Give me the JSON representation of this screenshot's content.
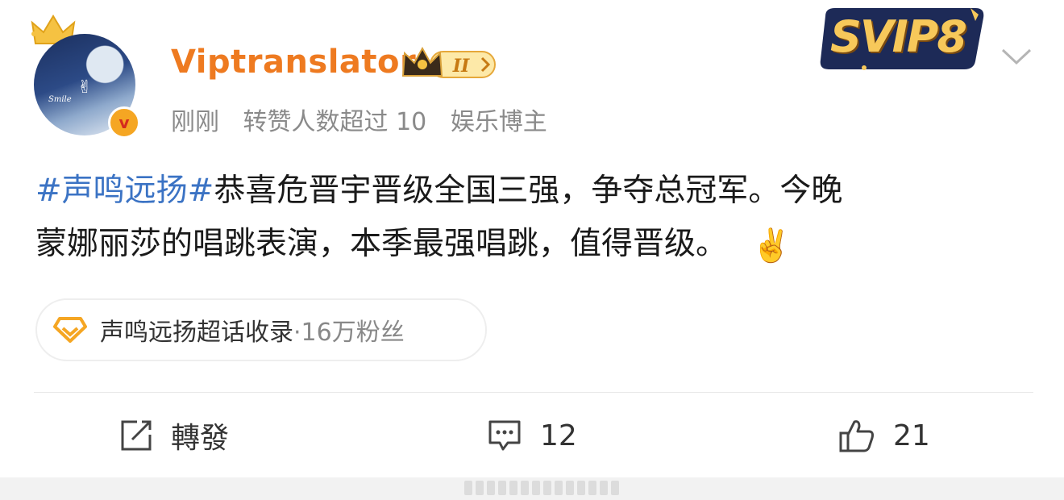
{
  "author": {
    "name": "Viptranslator",
    "level_badge": "II",
    "verified_mark": "v",
    "avatar_text": "Smile",
    "meta": {
      "time": "刚刚",
      "repost_note": "转赞人数超过 10",
      "role": "娱乐博主"
    }
  },
  "vip_badge": "SVIP8",
  "post": {
    "hashtag": "#声鸣远扬#",
    "text_line1_rest": "恭喜危晋宇晋级全国三强，争夺总冠军。今晚",
    "text_line2": "蒙娜丽莎的唱跳表演，本季最强唱跳，值得晋级。",
    "emoji": "✌️"
  },
  "topic": {
    "name": "声鸣远扬超话收录",
    "fans": "·16万粉丝"
  },
  "actions": {
    "repost_label": "轉發",
    "comment_count": "12",
    "like_count": "21"
  },
  "colors": {
    "username": "#ee7a20",
    "hashtag": "#3b73c4",
    "meta": "#8a8a8a"
  }
}
